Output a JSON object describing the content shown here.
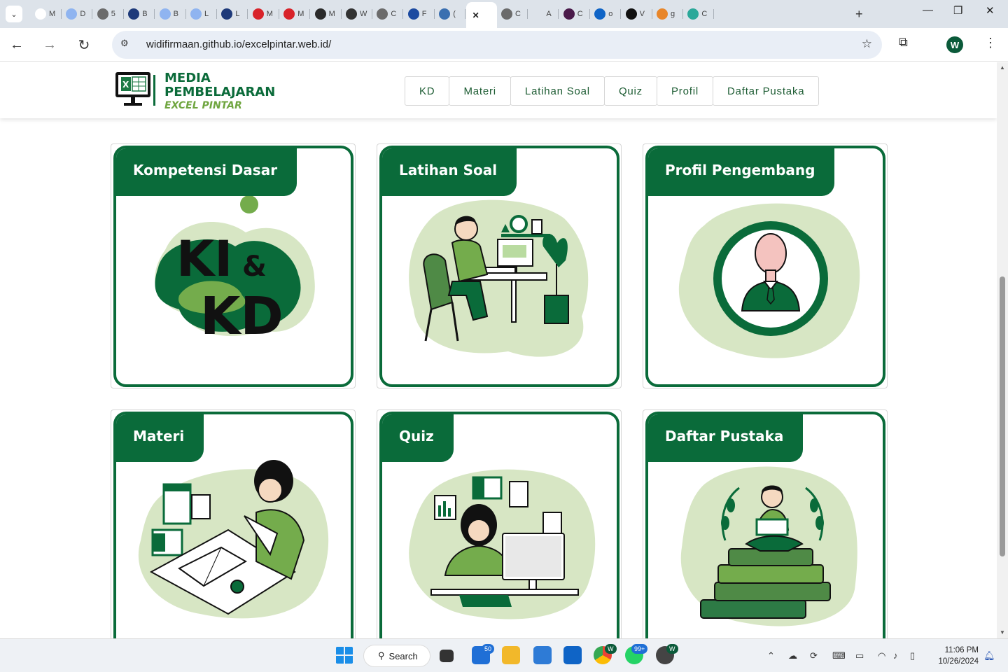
{
  "browser": {
    "tabs": [
      {
        "label": "M",
        "icon": "google-icon",
        "color": "#ffffff"
      },
      {
        "label": "D",
        "icon": "blogger-b-icon",
        "color": "#8fb4f0"
      },
      {
        "label": "5",
        "icon": "globe-icon",
        "color": "#6b6b6b"
      },
      {
        "label": "B",
        "icon": "book-icon",
        "color": "#1e3a7a"
      },
      {
        "label": "B",
        "icon": "blogger-b-icon",
        "color": "#8fb4f0"
      },
      {
        "label": "L",
        "icon": "blogger-b-icon",
        "color": "#8fb4f0"
      },
      {
        "label": "L",
        "icon": "book-icon",
        "color": "#1e3a7a"
      },
      {
        "label": "M",
        "icon": "mendeley-icon",
        "color": "#d8232a"
      },
      {
        "label": "M",
        "icon": "mendeley-icon",
        "color": "#d8232a"
      },
      {
        "label": "M",
        "icon": "chip-icon",
        "color": "#2a2a2a"
      },
      {
        "label": "W",
        "icon": "incognito-icon",
        "color": "#333333"
      },
      {
        "label": "C",
        "icon": "globe-icon",
        "color": "#6b6b6b"
      },
      {
        "label": "F",
        "icon": "f-icon",
        "color": "#1c4aa0"
      },
      {
        "label": "(",
        "icon": "cube-icon",
        "color": "#3a6fb0"
      },
      {
        "label": "",
        "icon": "close-icon",
        "color": "#ffffff",
        "active": true
      },
      {
        "label": "C",
        "icon": "globe-icon",
        "color": "#6b6b6b"
      },
      {
        "label": "A",
        "icon": "blank-icon",
        "color": "#dde3ea"
      },
      {
        "label": "C",
        "icon": "p-icon",
        "color": "#4a1a4a"
      },
      {
        "label": "o",
        "icon": "outlook-icon",
        "color": "#0f64c6"
      },
      {
        "label": "V",
        "icon": "github-icon",
        "color": "#111111"
      },
      {
        "label": "g",
        "icon": "stack-icon",
        "color": "#e8862a"
      },
      {
        "label": "C",
        "icon": "eye-icon",
        "color": "#2ba89a"
      }
    ],
    "url": "widifirmaan.github.io/excelpintar.web.id/",
    "profile_initial": "W"
  },
  "site": {
    "logo": {
      "line1": "MEDIA",
      "line2": "PEMBELAJARAN",
      "line3": "EXCEL PINTAR"
    },
    "nav": [
      "KD",
      "Materi",
      "Latihan Soal",
      "Quiz",
      "Profil",
      "Daftar Pustaka"
    ],
    "cards": [
      {
        "title": "Kompetensi Dasar",
        "art": "ki-kd"
      },
      {
        "title": "Latihan Soal",
        "art": "desk-worker"
      },
      {
        "title": "Profil Pengembang",
        "art": "profile-avatar"
      },
      {
        "title": "Materi",
        "art": "student-writing"
      },
      {
        "title": "Quiz",
        "art": "thinking-at-computer"
      },
      {
        "title": "Daftar Pustaka",
        "art": "reading-on-books"
      }
    ],
    "ki_kd_art": {
      "ki": "KI",
      "amp": "&",
      "kd": "KD"
    }
  },
  "taskbar": {
    "search_label": "Search",
    "badges": {
      "mail": "50",
      "whatsapp": "99+",
      "chrome": "W",
      "sync": "W"
    },
    "time": "11:06 PM",
    "date": "10/26/2024"
  },
  "colors": {
    "primary_green": "#0a6b3a",
    "light_green": "#d7e6c4",
    "mid_green": "#74ac4c"
  }
}
